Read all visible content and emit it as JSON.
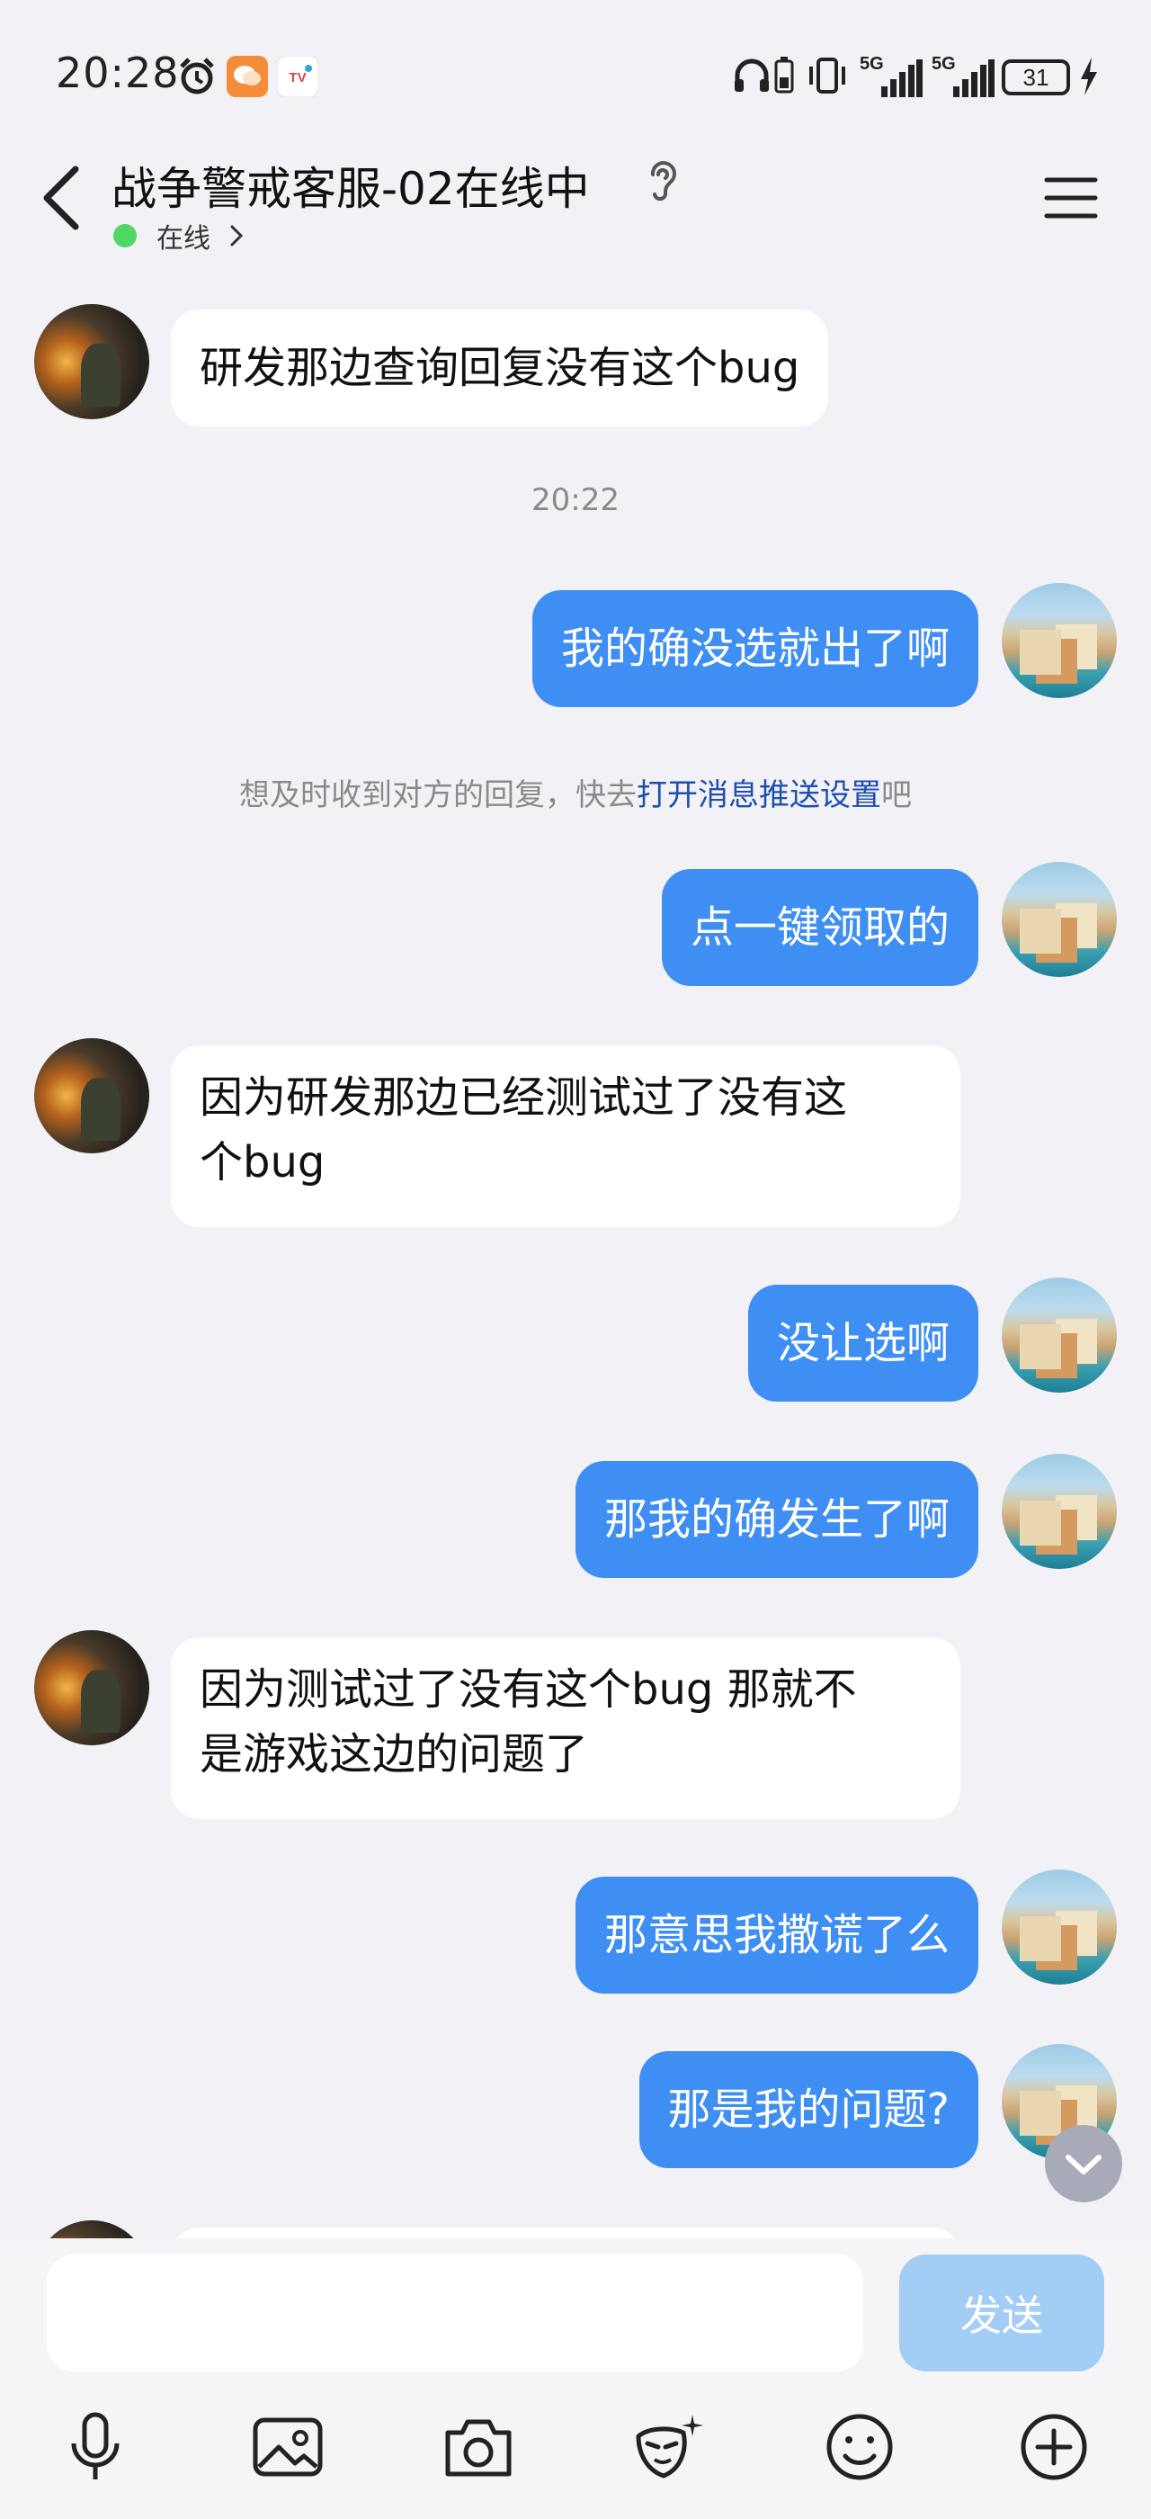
{
  "status_bar": {
    "time": "20:28",
    "battery": "31",
    "signal_1": "5G",
    "signal_2": "5G"
  },
  "header": {
    "title": "战争警戒客服-02在线中",
    "presence": "在线"
  },
  "messages": [
    {
      "side": "in",
      "text": "研发那边查询回复没有这个bug"
    },
    {
      "type": "time",
      "text": "20:22"
    },
    {
      "side": "out",
      "text": "我的确没选就出了啊"
    },
    {
      "type": "tip",
      "prefix": "想及时收到对方的回复，快去",
      "link": "打开消息推送设置",
      "suffix": "吧"
    },
    {
      "side": "out",
      "text": "点一键领取的"
    },
    {
      "side": "in",
      "line1": "因为研发那边已经测试过了没有这",
      "line2": "个bug"
    },
    {
      "side": "out",
      "text": "没让选啊"
    },
    {
      "side": "out",
      "text": "那我的确发生了啊"
    },
    {
      "side": "in",
      "line1": "因为测试过了没有这个bug 那就不",
      "line2": "是游戏这边的问题了"
    },
    {
      "side": "out",
      "text": "那意思我撒谎了么"
    },
    {
      "side": "out",
      "text": "那是我的问题?"
    }
  ],
  "input": {
    "placeholder": "",
    "send_label": "发送"
  },
  "toolbar_icons": [
    "microphone-icon",
    "image-icon",
    "camera-icon",
    "redpacket-mask-icon",
    "emoji-icon",
    "plus-icon"
  ],
  "colors": {
    "background": "#f2f2f6",
    "outgoing_bubble": "#3e8ef3",
    "incoming_bubble": "#ffffff",
    "presence_dot": "#4fd865",
    "link": "#1f4fae",
    "send_disabled": "#a4cdf6"
  }
}
